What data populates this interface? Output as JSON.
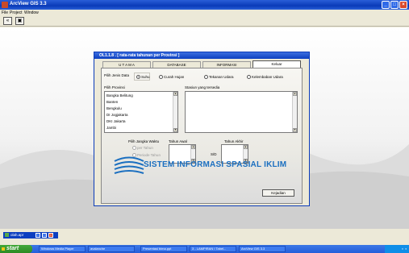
{
  "app": {
    "title": "ArcView GIS 3.3"
  },
  "menu": [
    "File",
    "Project",
    "Window"
  ],
  "dialog": {
    "title": "OL1.1.8 . [ rata-rata tahunan per Provinsi ]",
    "tabs": [
      "U T A M A",
      "DATABASE",
      "INFORMASI",
      "Keluar"
    ],
    "active_tab": "Keluar",
    "jenis_data": {
      "label": "Pilih Jenis Data",
      "options": [
        "Suhu",
        "Curah Hujan",
        "Tekanan Udara",
        "Kelembaban Udara"
      ],
      "selected": "Suhu"
    },
    "provinsi": {
      "label": "Pilih Provinsi",
      "items": [
        "Bangka Belitung",
        "Banten",
        "Bengkulu",
        "DI Jogjakarta",
        "DKI Jakarta",
        "Jambi"
      ]
    },
    "stasiun": {
      "label": "Stasiun yang tersedia"
    },
    "jangka": {
      "label": "Pilih Jangka Waktu",
      "options": [
        "per Tahun",
        "Periode Tahun"
      ]
    },
    "tahun_awal": {
      "label": "Tahun Awal"
    },
    "tahun_akhir": {
      "label": "Tahun Akhir"
    },
    "separator": "S/D",
    "banner": "SISTEM INFORMASI SPASIAL IKLIM",
    "kejadian_button": "Kejadian"
  },
  "minimized_window": {
    "title": "olah.apr"
  },
  "taskbar": {
    "start": "start",
    "tasks": [
      "Windows Media Player",
      "avalanche",
      "Presentasi bima.ppt",
      "3 - LAMPIRAN I Tabel...",
      "ArcView GIS 3.3"
    ]
  }
}
